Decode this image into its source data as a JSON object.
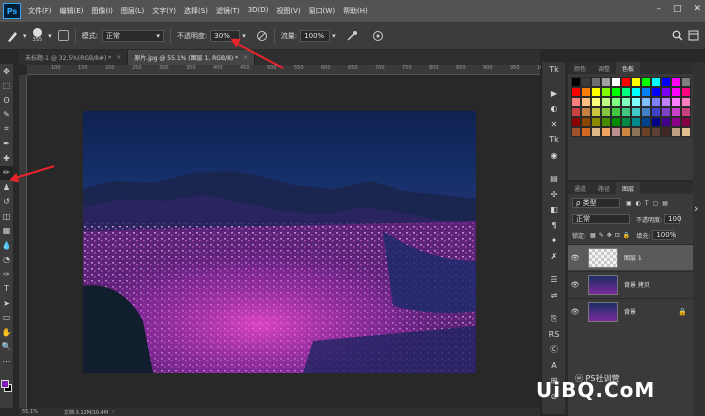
{
  "app": {
    "logo_text": "Ps"
  },
  "menu": [
    "文件(F)",
    "编辑(E)",
    "图像(I)",
    "图层(L)",
    "文字(Y)",
    "选择(S)",
    "滤镜(T)",
    "3D(D)",
    "视图(V)",
    "窗口(W)",
    "帮助(H)"
  ],
  "window_controls": [
    "–",
    "□",
    "✕"
  ],
  "options": {
    "brush_size": "355",
    "mode_label": "模式:",
    "mode_value": "正常",
    "opacity_label": "不透明度:",
    "opacity_value": "30%",
    "flow_label": "流量:",
    "flow_value": "100%"
  },
  "tabs": [
    {
      "label": "未标题-1 @ 32.5%(RGB/8#) *",
      "active": false
    },
    {
      "label": "原片.jpg @ 55.1% (图层 1, RGB/8) *",
      "active": true
    }
  ],
  "ruler_ticks": [
    "100",
    "150",
    "200",
    "250",
    "300",
    "350",
    "400",
    "450",
    "500",
    "550",
    "600",
    "650",
    "700",
    "750",
    "800",
    "850",
    "900",
    "950",
    "1000"
  ],
  "status": {
    "zoom": "55.1%",
    "doc": "文档:3.12M/10.4M"
  },
  "swatch_panel": {
    "tabs": [
      "颜色",
      "调整",
      "色板"
    ],
    "active_tab": "色板",
    "colors": [
      "#000000",
      "#3a3a3a",
      "#6e6e6e",
      "#a0a0a0",
      "#ffffff",
      "#ff0000",
      "#ffff00",
      "#00ff00",
      "#00ffff",
      "#0000ff",
      "#ff00ff",
      "#7f7f7f",
      "#ff0000",
      "#ff8000",
      "#ffff00",
      "#80ff00",
      "#00ff00",
      "#00ff80",
      "#00ffff",
      "#0080ff",
      "#0000ff",
      "#8000ff",
      "#ff00ff",
      "#ff0080",
      "#ff7f7f",
      "#ffbf7f",
      "#ffff7f",
      "#bfff7f",
      "#7fff7f",
      "#7fffbf",
      "#7fffff",
      "#7fbfff",
      "#7f7fff",
      "#bf7fff",
      "#ff7fff",
      "#ff7fbf",
      "#c84040",
      "#c88040",
      "#c8c840",
      "#80c840",
      "#40c840",
      "#40c880",
      "#40c8c8",
      "#4080c8",
      "#4040c8",
      "#8040c8",
      "#c840c8",
      "#c84080",
      "#8b0000",
      "#8b4500",
      "#8b8b00",
      "#458b00",
      "#008b00",
      "#008b45",
      "#008b8b",
      "#00458b",
      "#00008b",
      "#45008b",
      "#8b008b",
      "#8b0045",
      "#a0522d",
      "#d2691e",
      "#deb887",
      "#f4a460",
      "#bc8f8f",
      "#cd853f",
      "#8b7355",
      "#6b4226",
      "#5c4033",
      "#3e2723",
      "#c0a080",
      "#e0c090"
    ]
  },
  "layers_panel": {
    "tabs": [
      "通道",
      "路径",
      "图层"
    ],
    "active_tab": "图层",
    "filter_kind": "ρ 类型",
    "blend_mode": "正常",
    "opacity_label": "不透明度:",
    "opacity_value": "100",
    "lock_label": "锁定:",
    "fill_label": "填充:",
    "fill_value": "100%",
    "layers": [
      {
        "name": "图层 1",
        "active": true
      },
      {
        "name": "背景 拷贝",
        "active": false
      },
      {
        "name": "背景",
        "active": false
      }
    ]
  },
  "watermark": "UiBQ.CoM",
  "watermark_small": "ⓦ PS社训营"
}
